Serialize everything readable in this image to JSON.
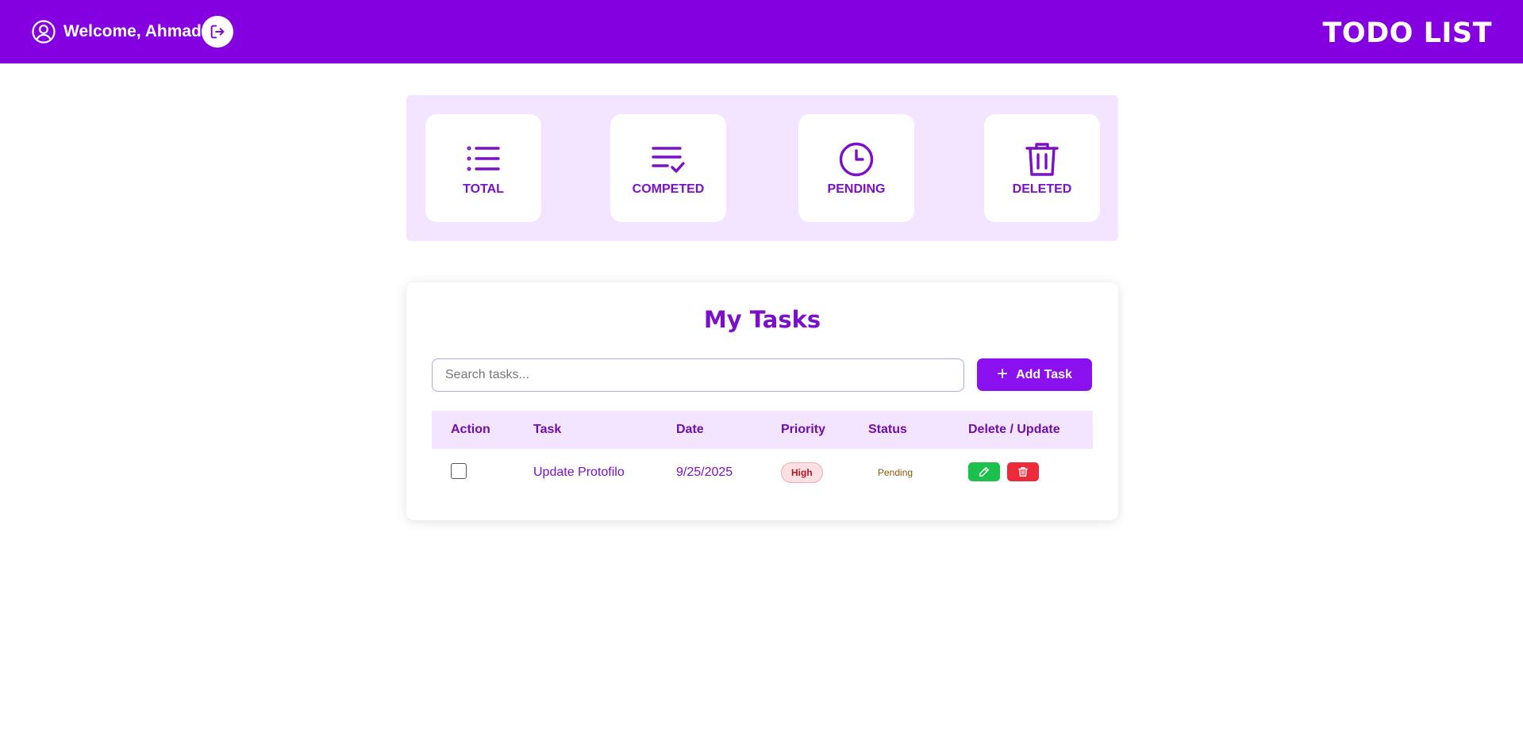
{
  "header": {
    "welcome_text": "Welcome, Ahmad",
    "brand": "TODO LIST",
    "user_icon": "user-circle-icon",
    "logout_icon": "logout-icon"
  },
  "stats": [
    {
      "label": "TOTAL",
      "icon": "list-icon"
    },
    {
      "label": "COMPETED",
      "icon": "list-check-icon"
    },
    {
      "label": "PENDING",
      "icon": "clock-icon"
    },
    {
      "label": "DELETED",
      "icon": "trash-icon"
    }
  ],
  "tasks": {
    "title": "My Tasks",
    "search_placeholder": "Search tasks...",
    "add_button_label": "Add Task",
    "columns": [
      "Action",
      "Task",
      "Date",
      "Priority",
      "Status",
      "Delete / Update"
    ],
    "rows": [
      {
        "checked": false,
        "task": "Update Protofilo",
        "date": "9/25/2025",
        "priority": "High",
        "status": "Pending"
      }
    ]
  },
  "colors": {
    "primary": "#8400e0",
    "accent_text": "#7a10c8",
    "stats_bg": "#f3e5ff",
    "edit": "#1cc04c",
    "delete": "#ec2a3a"
  }
}
